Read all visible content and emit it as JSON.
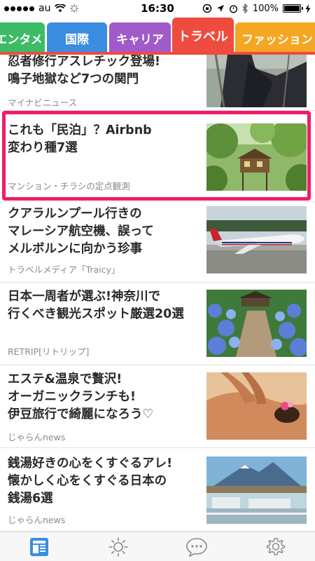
{
  "status_bar": {
    "carrier": "au",
    "time": "16:30",
    "battery": "100%"
  },
  "tabs": [
    {
      "label": "エンタメ",
      "color": "#3dbb67",
      "active": false
    },
    {
      "label": "国際",
      "color": "#3a8de0",
      "active": false
    },
    {
      "label": "キャリア",
      "color": "#a15ac9",
      "active": false
    },
    {
      "label": "トラベル",
      "color": "#ef4b3f",
      "active": true
    },
    {
      "label": "ファッション",
      "color": "#f5a623",
      "active": false
    }
  ],
  "articles": [
    {
      "title_lines": [
        "忍者修行アスレチック登場!",
        "鳴子地獄など7つの関門"
      ],
      "source": "マイナビニュース",
      "thumb": "ninja-photo"
    },
    {
      "title_lines": [
        "これも「民泊」？Airbnb",
        "変わり種7選"
      ],
      "source": "マンション・チラシの定点観測",
      "thumb": "treehouse-photo",
      "highlighted": true
    },
    {
      "title_lines": [
        "クアラルンプール行きの",
        "マレーシア航空機、誤って",
        "メルボルンに向かう珍事"
      ],
      "source": "トラベルメディア「Traicy」",
      "thumb": "airplane-photo"
    },
    {
      "title_lines": [
        "日本一周者が選ぶ!神奈川で",
        "行くべき観光スポット厳選20選"
      ],
      "source": "RETRIP[リトリップ]",
      "thumb": "hydrangea-path-photo"
    },
    {
      "title_lines": [
        "エステ&温泉で贅沢!",
        "オーガニックランチも!",
        "伊豆旅行で綺麗になろう♡"
      ],
      "source": "じゃらんnews",
      "thumb": "massage-photo"
    },
    {
      "title_lines": [
        "銭湯好きの心をくすぐるアレ!",
        "懐かしく心をくすぐる日本の",
        "銭湯6選"
      ],
      "source": "じゃらんnews",
      "thumb": "bathhouse-photo"
    }
  ],
  "bottom_nav": [
    {
      "icon": "news-icon",
      "active": true
    },
    {
      "icon": "weather-sun-icon",
      "active": false
    },
    {
      "icon": "chat-bubble-icon",
      "active": false
    },
    {
      "icon": "settings-gear-icon",
      "active": false
    }
  ],
  "colors": {
    "accent": "#ef4b3f",
    "highlight_border": "#ee1d6a",
    "active_nav": "#3a8de0"
  }
}
